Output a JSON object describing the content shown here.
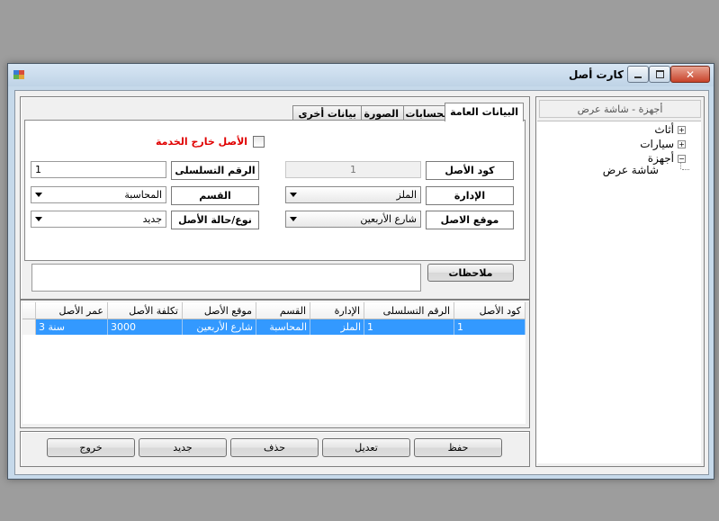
{
  "window": {
    "title": "كارت أصل"
  },
  "tabs": [
    "البيانات العامة",
    "الحسابات",
    "الصورة",
    "بيانات أخرى"
  ],
  "general": {
    "out_of_service_label": "الأصل خارج الخدمة",
    "asset_code_label": "كود الأصل",
    "asset_code_value": "1",
    "serial_label": "الرقم التسلسلى",
    "serial_value": "1",
    "department_label": "الإدارة",
    "department_value": "الملز",
    "section_label": "القسم",
    "section_value": "المحاسبة",
    "location_label": "موقع الاصل",
    "location_value": "شارع الأربعين",
    "type_label": "نوع/حالة الأصل",
    "type_value": "جديد",
    "notes_label": "ملاحظات",
    "notes_value": ""
  },
  "grid": {
    "columns": [
      "كود الأصل",
      "الرقم التسلسلى",
      "الإدارة",
      "القسم",
      "موقع الأصل",
      "تكلفة الأصل",
      "عمر الأصل"
    ],
    "rows": [
      [
        "1",
        "1",
        "الملز",
        "المحاسبة",
        "شارع الأربعين",
        "3000",
        "3 سنة"
      ]
    ]
  },
  "buttons": {
    "save": "حفظ",
    "edit": "تعديل",
    "delete": "حذف",
    "new": "جديد",
    "exit": "خروج"
  },
  "tree": {
    "breadcrumb": "أجهزة - شاشة عرض",
    "items": [
      {
        "label": "أثاث",
        "expander": "+"
      },
      {
        "label": "سيارات",
        "expander": "+"
      },
      {
        "label": "أجهزة",
        "expander": "−"
      },
      {
        "label": "شاشة عرض",
        "expander": ""
      }
    ]
  },
  "colors": {
    "selection": "#3399ff",
    "warning_label": "#e00000"
  }
}
